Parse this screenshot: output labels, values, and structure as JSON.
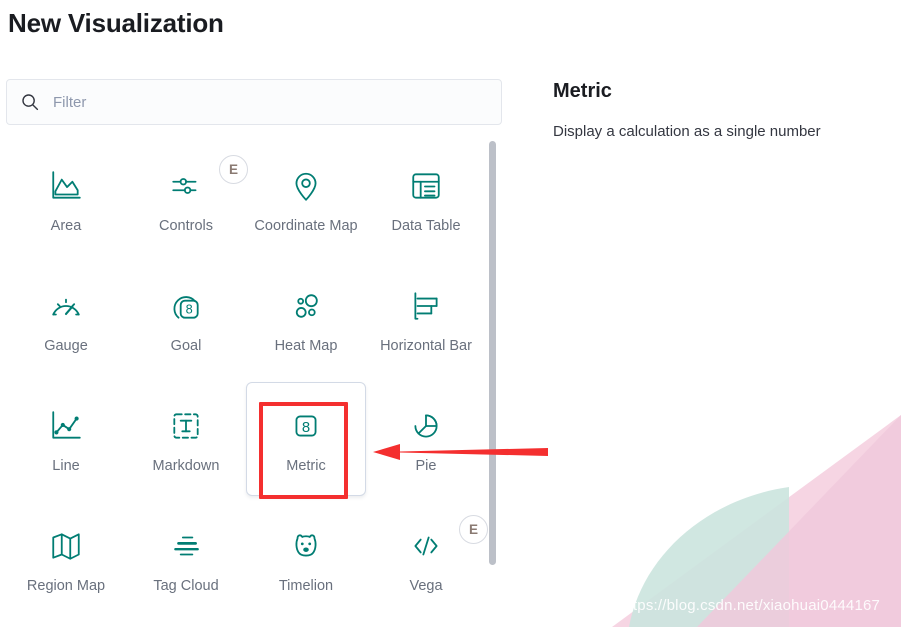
{
  "page": {
    "title": "New Visualization"
  },
  "search": {
    "placeholder": "Filter",
    "value": "",
    "icon": "search-icon"
  },
  "colors": {
    "icon_teal": "#017D73",
    "annotation_red": "#F42F2F",
    "label_gray": "#69707D",
    "title_dark": "#1A1C21",
    "card_border": "#D3DAE6",
    "scrollbar": "#BCC0C8",
    "deco_mint": "#CFE6E0",
    "deco_pink": "#F6D3E1",
    "deco_blend": "#C4BCCB"
  },
  "vis_types": [
    {
      "label": "Area",
      "icon": "area-chart-icon",
      "experimental": false,
      "selected": false
    },
    {
      "label": "Controls",
      "icon": "controls-icon",
      "experimental": true,
      "badge": "E",
      "selected": false
    },
    {
      "label": "Coordinate Map",
      "icon": "map-pin-icon",
      "experimental": false,
      "selected": false
    },
    {
      "label": "Data Table",
      "icon": "data-table-icon",
      "experimental": false,
      "selected": false
    },
    {
      "label": "Gauge",
      "icon": "gauge-icon",
      "experimental": false,
      "selected": false
    },
    {
      "label": "Goal",
      "icon": "goal-icon",
      "experimental": false,
      "selected": false
    },
    {
      "label": "Heat Map",
      "icon": "heat-map-icon",
      "experimental": false,
      "selected": false
    },
    {
      "label": "Horizontal Bar",
      "icon": "horizontal-bar-icon",
      "experimental": false,
      "selected": false
    },
    {
      "label": "Line",
      "icon": "line-chart-icon",
      "experimental": false,
      "selected": false
    },
    {
      "label": "Markdown",
      "icon": "markdown-icon",
      "experimental": false,
      "selected": false
    },
    {
      "label": "Metric",
      "icon": "metric-icon",
      "experimental": false,
      "selected": true
    },
    {
      "label": "Pie",
      "icon": "pie-chart-icon",
      "experimental": false,
      "selected": false
    },
    {
      "label": "Region Map",
      "icon": "region-map-icon",
      "experimental": false,
      "selected": false
    },
    {
      "label": "Tag Cloud",
      "icon": "tag-cloud-icon",
      "experimental": false,
      "selected": false
    },
    {
      "label": "Timelion",
      "icon": "timelion-icon",
      "experimental": false,
      "selected": false
    },
    {
      "label": "Vega",
      "icon": "vega-icon",
      "experimental": true,
      "badge": "E",
      "selected": false
    }
  ],
  "detail": {
    "title": "Metric",
    "description": "Display a calculation as a single number"
  },
  "annotation": {
    "box_target": "Metric",
    "arrow_direction": "left"
  },
  "watermark": {
    "text": "https://blog.csdn.net/xiaohuai0444167"
  }
}
